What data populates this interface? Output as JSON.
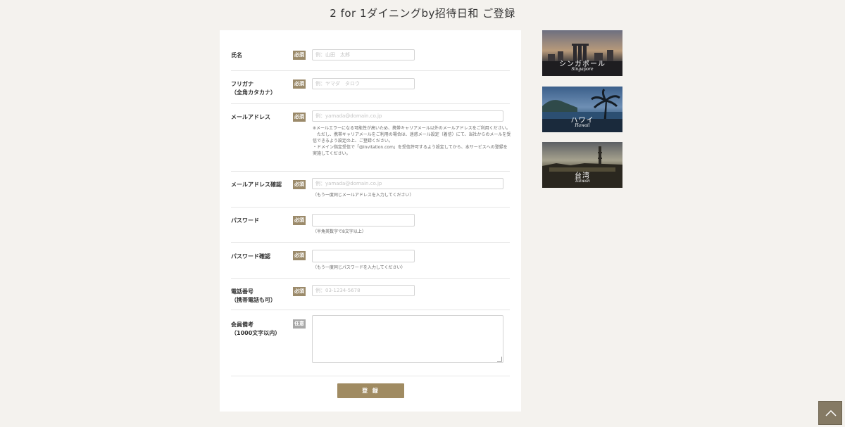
{
  "page": {
    "title": "2 for 1ダイニングby招待日和 ご登録"
  },
  "form": {
    "required_badge": "必須",
    "optional_badge": "任意",
    "fields": {
      "name": {
        "label": "氏名",
        "placeholder": "例：山田　太郎"
      },
      "furigana": {
        "label": "フリガナ\n（全角カタカナ）",
        "placeholder": "例：ヤマダ　タロウ"
      },
      "email": {
        "label": "メールアドレス",
        "placeholder": "例：yamada@domain.co.jp",
        "note": "※メールエラーになる可能性が高いため、携帯キャリアメール以外のメールアドレスをご利用ください。\n　ただし、携帯キャリアメールをご利用の場合は、迷惑メール設定（着信）にて、当社からのメールを受信できるよう設定の上、ご登録ください。\n・ドメイン指定受信で「@invitation.com」を受信許可するよう設定してから、本サービスへの登録を実施してください。"
      },
      "email_confirm": {
        "label": "メールアドレス確認",
        "placeholder": "例：yamada@domain.co.jp",
        "note": "（もう一度同じメールアドレスを入力してください）"
      },
      "password": {
        "label": "パスワード",
        "placeholder": "",
        "note": "（半角英数字で8文字以上）"
      },
      "password_confirm": {
        "label": "パスワード確認",
        "placeholder": "",
        "note": "（もう一度同じパスワードを入力してください）"
      },
      "phone": {
        "label": "電話番号\n（携帯電話も可）",
        "placeholder": "例：03-1234-5678"
      },
      "remarks": {
        "label": "会員備考\n（1000文字以内）"
      }
    },
    "submit_label": "登 録"
  },
  "destinations": [
    {
      "name": "シンガポール",
      "sub": "Singapore"
    },
    {
      "name": "ハワイ",
      "sub": "Hawaii"
    },
    {
      "name": "台湾",
      "sub": "Taiwan"
    }
  ],
  "icons": {
    "scroll_top": "chevron-up-icon"
  },
  "colors": {
    "accent": "#a08b62",
    "badge": "#9b8a6a",
    "background": "#f4f2ee"
  }
}
